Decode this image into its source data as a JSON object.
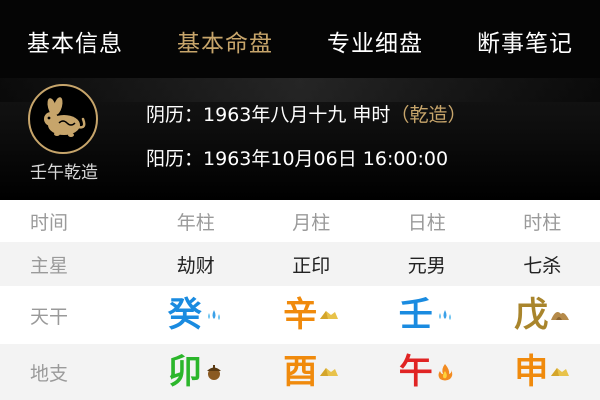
{
  "tabs": [
    {
      "label": "基本信息",
      "active": false
    },
    {
      "label": "基本命盘",
      "active": true
    },
    {
      "label": "专业细盘",
      "active": false
    },
    {
      "label": "断事笔记",
      "active": false
    }
  ],
  "profile": {
    "emblem_icon": "rat-zodiac-icon",
    "caption": "壬午乾造",
    "lunar_label": "阴历：",
    "lunar_date": "1963年八月十九",
    "lunar_hour": "申时",
    "gender_tag": "（乾造）",
    "solar_label": "阳历：",
    "solar_date": "1963年10月06日 16:00:00"
  },
  "table": {
    "headers": [
      "时间",
      "年柱",
      "月柱",
      "日柱",
      "时柱"
    ],
    "stars_label": "主星",
    "stars": [
      "劫财",
      "正印",
      "元男",
      "七杀"
    ],
    "stems_label": "天干",
    "stems": [
      {
        "char": "癸",
        "color": "#1a8be0",
        "element_icon": "water-drops-icon"
      },
      {
        "char": "辛",
        "color": "#f08a0c",
        "element_icon": "gold-nugget-icon"
      },
      {
        "char": "壬",
        "color": "#1a8be0",
        "element_icon": "water-drops-icon"
      },
      {
        "char": "戊",
        "color": "#a9852c",
        "element_icon": "earth-mound-icon"
      }
    ],
    "branches_label": "地支",
    "branches": [
      {
        "char": "卯",
        "color": "#2bb62b",
        "element_icon": "wood-acorn-icon"
      },
      {
        "char": "酉",
        "color": "#f08a0c",
        "element_icon": "gold-nugget-icon"
      },
      {
        "char": "午",
        "color": "#e02424",
        "element_icon": "fire-flame-icon"
      },
      {
        "char": "申",
        "color": "#f08a0c",
        "element_icon": "gold-nugget-icon"
      }
    ]
  }
}
